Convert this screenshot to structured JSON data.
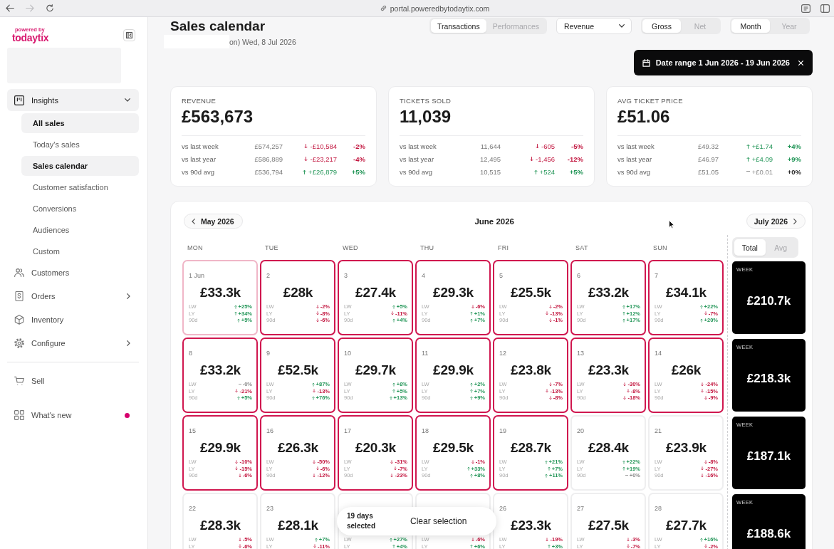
{
  "browser": {
    "nav_buttons": [
      {
        "kind": "back",
        "disabled": false
      },
      {
        "kind": "forward",
        "disabled": true
      },
      {
        "kind": "reload",
        "disabled": false
      }
    ],
    "url": "portal.poweredbytodaytix.com"
  },
  "sidebar": {
    "logo": {
      "tagline": "powered by",
      "wordmark": "todaytix"
    },
    "sections": [
      {
        "items": [
          {
            "label": "Insights",
            "kind": "group",
            "expanded": true,
            "unread": false,
            "children": [
              {
                "label": "All sales",
                "selected": true
              },
              {
                "label": "Today's sales",
                "selected": false
              },
              {
                "label": "Sales calendar",
                "selected": true
              },
              {
                "label": "Customer satisfaction",
                "selected": false
              },
              {
                "label": "Conversions",
                "selected": false
              },
              {
                "label": "Audiences",
                "selected": false
              },
              {
                "label": "Custom",
                "selected": false
              }
            ]
          },
          {
            "label": "Customers",
            "kind": "link",
            "unread": false
          },
          {
            "label": "Orders",
            "kind": "group",
            "expanded": false,
            "unread": false
          },
          {
            "label": "Inventory",
            "kind": "link",
            "unread": false
          },
          {
            "label": "Configure",
            "kind": "group",
            "expanded": false,
            "unread": false
          }
        ]
      },
      {
        "items": [
          {
            "label": "Sell",
            "kind": "link",
            "unread": false
          },
          {
            "label": "What's new",
            "kind": "link",
            "unread": true
          }
        ]
      }
    ]
  },
  "header": {
    "title": "Sales calendar",
    "subtitle": "on) Wed, 8 Jul 2026",
    "view_tabs": [
      {
        "label": "Transactions",
        "selected": true
      },
      {
        "label": "Performances",
        "selected": false
      }
    ],
    "metric_select": {
      "value": "Revenue"
    },
    "amount_tabs": [
      {
        "label": "Gross",
        "selected": true
      },
      {
        "label": "Net",
        "selected": false
      }
    ],
    "period_tabs": [
      {
        "label": "Month",
        "selected": true
      },
      {
        "label": "Year",
        "selected": false
      }
    ],
    "date_range": {
      "label": "Date range 1 Jun 2026 - 19 Jun 2026"
    }
  },
  "stats": [
    {
      "label": "REVENUE",
      "value": "£563,673",
      "rows": [
        {
          "label": "vs last week",
          "previous": "£574,257",
          "change": "-£10,584",
          "percent": "-2%",
          "kind": "down"
        },
        {
          "label": "vs last year",
          "previous": "£586,889",
          "change": "-£23,217",
          "percent": "-4%",
          "kind": "down"
        },
        {
          "label": "vs 90d avg",
          "previous": "£536,794",
          "change": "+£26,879",
          "percent": "+5%",
          "kind": "up"
        }
      ]
    },
    {
      "label": "TICKETS SOLD",
      "value": "11,039",
      "rows": [
        {
          "label": "vs last week",
          "previous": "11,644",
          "change": "-605",
          "percent": "-5%",
          "kind": "down"
        },
        {
          "label": "vs last year",
          "previous": "12,495",
          "change": "-1,456",
          "percent": "-12%",
          "kind": "down"
        },
        {
          "label": "vs 90d avg",
          "previous": "10,515",
          "change": "+524",
          "percent": "+5%",
          "kind": "up"
        }
      ]
    },
    {
      "label": "AVG TICKET PRICE",
      "value": "£51.06",
      "rows": [
        {
          "label": "vs last week",
          "previous": "£49.32",
          "change": "+£1.74",
          "percent": "+4%",
          "kind": "up"
        },
        {
          "label": "vs last year",
          "previous": "£46.97",
          "change": "+£4.09",
          "percent": "+9%",
          "kind": "up"
        },
        {
          "label": "vs 90d avg",
          "previous": "£51.05",
          "change": "+£0.01",
          "percent": "+0%",
          "kind": "flat"
        }
      ]
    }
  ],
  "calendar": {
    "prev_month": "May 2026",
    "title": "June 2026",
    "next_month": "July 2026",
    "weekdays": [
      "MON",
      "TUE",
      "WED",
      "THU",
      "FRI",
      "SAT",
      "SUN"
    ],
    "summary_tabs": [
      {
        "label": "Total",
        "selected": true
      },
      {
        "label": "Avg",
        "selected": false
      }
    ],
    "weeks": [
      {
        "days": [
          {
            "date": "1 Jun",
            "value": "£33.3k",
            "selected": true,
            "anchor": true,
            "metrics": [
              {
                "label": "LW",
                "change": "+25%",
                "kind": "up"
              },
              {
                "label": "LY",
                "change": "+34%",
                "kind": "up"
              },
              {
                "label": "90d",
                "change": "+5%",
                "kind": "up"
              }
            ]
          },
          {
            "date": "2",
            "value": "£28k",
            "selected": true,
            "anchor": false,
            "metrics": [
              {
                "label": "LW",
                "change": "-2%",
                "kind": "down"
              },
              {
                "label": "LY",
                "change": "-8%",
                "kind": "down"
              },
              {
                "label": "90d",
                "change": "-6%",
                "kind": "down"
              }
            ]
          },
          {
            "date": "3",
            "value": "£27.4k",
            "selected": true,
            "anchor": false,
            "metrics": [
              {
                "label": "LW",
                "change": "+5%",
                "kind": "up"
              },
              {
                "label": "LY",
                "change": "-11%",
                "kind": "down"
              },
              {
                "label": "90d",
                "change": "+4%",
                "kind": "up"
              }
            ]
          },
          {
            "date": "4",
            "value": "£29.3k",
            "selected": true,
            "anchor": false,
            "metrics": [
              {
                "label": "LW",
                "change": "-6%",
                "kind": "down"
              },
              {
                "label": "LY",
                "change": "+1%",
                "kind": "up"
              },
              {
                "label": "90d",
                "change": "+7%",
                "kind": "up"
              }
            ]
          },
          {
            "date": "5",
            "value": "£25.5k",
            "selected": true,
            "anchor": false,
            "metrics": [
              {
                "label": "LW",
                "change": "-2%",
                "kind": "down"
              },
              {
                "label": "LY",
                "change": "-13%",
                "kind": "down"
              },
              {
                "label": "90d",
                "change": "-1%",
                "kind": "down"
              }
            ]
          },
          {
            "date": "6",
            "value": "£33.2k",
            "selected": true,
            "anchor": false,
            "metrics": [
              {
                "label": "LW",
                "change": "+17%",
                "kind": "up"
              },
              {
                "label": "LY",
                "change": "+12%",
                "kind": "up"
              },
              {
                "label": "90d",
                "change": "+17%",
                "kind": "up"
              }
            ]
          },
          {
            "date": "7",
            "value": "£34.1k",
            "selected": true,
            "anchor": false,
            "metrics": [
              {
                "label": "LW",
                "change": "+22%",
                "kind": "up"
              },
              {
                "label": "LY",
                "change": "-7%",
                "kind": "down"
              },
              {
                "label": "90d",
                "change": "+20%",
                "kind": "up"
              }
            ]
          }
        ],
        "total": {
          "label": "WEEK",
          "value": "£210.7k"
        }
      },
      {
        "days": [
          {
            "date": "8",
            "value": "£33.2k",
            "selected": true,
            "anchor": false,
            "metrics": [
              {
                "label": "LW",
                "change": "-0%",
                "kind": "flat"
              },
              {
                "label": "LY",
                "change": "-21%",
                "kind": "down"
              },
              {
                "label": "90d",
                "change": "+5%",
                "kind": "up"
              }
            ]
          },
          {
            "date": "9",
            "value": "£52.5k",
            "selected": true,
            "anchor": false,
            "metrics": [
              {
                "label": "LW",
                "change": "+87%",
                "kind": "up"
              },
              {
                "label": "LY",
                "change": "-13%",
                "kind": "down"
              },
              {
                "label": "90d",
                "change": "+76%",
                "kind": "up"
              }
            ]
          },
          {
            "date": "10",
            "value": "£29.7k",
            "selected": true,
            "anchor": false,
            "metrics": [
              {
                "label": "LW",
                "change": "+8%",
                "kind": "up"
              },
              {
                "label": "LY",
                "change": "+5%",
                "kind": "up"
              },
              {
                "label": "90d",
                "change": "+13%",
                "kind": "up"
              }
            ]
          },
          {
            "date": "11",
            "value": "£29.9k",
            "selected": true,
            "anchor": false,
            "metrics": [
              {
                "label": "LW",
                "change": "+2%",
                "kind": "up"
              },
              {
                "label": "LY",
                "change": "+7%",
                "kind": "up"
              },
              {
                "label": "90d",
                "change": "+9%",
                "kind": "up"
              }
            ]
          },
          {
            "date": "12",
            "value": "£23.8k",
            "selected": true,
            "anchor": false,
            "metrics": [
              {
                "label": "LW",
                "change": "-7%",
                "kind": "down"
              },
              {
                "label": "LY",
                "change": "-13%",
                "kind": "down"
              },
              {
                "label": "90d",
                "change": "-8%",
                "kind": "down"
              }
            ]
          },
          {
            "date": "13",
            "value": "£23.3k",
            "selected": true,
            "anchor": false,
            "metrics": [
              {
                "label": "LW",
                "change": "-30%",
                "kind": "down"
              },
              {
                "label": "LY",
                "change": "-8%",
                "kind": "down"
              },
              {
                "label": "90d",
                "change": "-18%",
                "kind": "down"
              }
            ]
          },
          {
            "date": "14",
            "value": "£26k",
            "selected": true,
            "anchor": false,
            "metrics": [
              {
                "label": "LW",
                "change": "-24%",
                "kind": "down"
              },
              {
                "label": "LY",
                "change": "-15%",
                "kind": "down"
              },
              {
                "label": "90d",
                "change": "-9%",
                "kind": "down"
              }
            ]
          }
        ],
        "total": {
          "label": "WEEK",
          "value": "£218.3k"
        }
      },
      {
        "days": [
          {
            "date": "15",
            "value": "£29.9k",
            "selected": true,
            "anchor": false,
            "metrics": [
              {
                "label": "LW",
                "change": "-10%",
                "kind": "down"
              },
              {
                "label": "LY",
                "change": "-15%",
                "kind": "down"
              },
              {
                "label": "90d",
                "change": "-6%",
                "kind": "down"
              }
            ]
          },
          {
            "date": "16",
            "value": "£26.3k",
            "selected": true,
            "anchor": false,
            "metrics": [
              {
                "label": "LW",
                "change": "-50%",
                "kind": "down"
              },
              {
                "label": "LY",
                "change": "-6%",
                "kind": "down"
              },
              {
                "label": "90d",
                "change": "-12%",
                "kind": "down"
              }
            ]
          },
          {
            "date": "17",
            "value": "£20.3k",
            "selected": true,
            "anchor": false,
            "metrics": [
              {
                "label": "LW",
                "change": "-31%",
                "kind": "down"
              },
              {
                "label": "LY",
                "change": "-7%",
                "kind": "down"
              },
              {
                "label": "90d",
                "change": "-23%",
                "kind": "down"
              }
            ]
          },
          {
            "date": "18",
            "value": "£29.5k",
            "selected": true,
            "anchor": false,
            "metrics": [
              {
                "label": "LW",
                "change": "-1%",
                "kind": "down"
              },
              {
                "label": "LY",
                "change": "+33%",
                "kind": "up"
              },
              {
                "label": "90d",
                "change": "+8%",
                "kind": "up"
              }
            ]
          },
          {
            "date": "19",
            "value": "£28.7k",
            "selected": true,
            "anchor": false,
            "metrics": [
              {
                "label": "LW",
                "change": "+21%",
                "kind": "up"
              },
              {
                "label": "LY",
                "change": "+7%",
                "kind": "up"
              },
              {
                "label": "90d",
                "change": "+11%",
                "kind": "up"
              }
            ]
          },
          {
            "date": "20",
            "value": "£28.4k",
            "selected": false,
            "anchor": false,
            "metrics": [
              {
                "label": "LW",
                "change": "+22%",
                "kind": "up"
              },
              {
                "label": "LY",
                "change": "+19%",
                "kind": "up"
              },
              {
                "label": "90d",
                "change": "+0%",
                "kind": "flat"
              }
            ]
          },
          {
            "date": "21",
            "value": "£23.9k",
            "selected": false,
            "anchor": false,
            "metrics": [
              {
                "label": "LW",
                "change": "-8%",
                "kind": "down"
              },
              {
                "label": "LY",
                "change": "-27%",
                "kind": "down"
              },
              {
                "label": "90d",
                "change": "-16%",
                "kind": "down"
              }
            ]
          }
        ],
        "total": {
          "label": "WEEK",
          "value": "£187.1k"
        }
      },
      {
        "days": [
          {
            "date": "22",
            "value": "£28.3k",
            "selected": false,
            "anchor": false,
            "metrics": [
              {
                "label": "LW",
                "change": "-5%",
                "kind": "down"
              },
              {
                "label": "LY",
                "change": "-6%",
                "kind": "down"
              }
            ]
          },
          {
            "date": "23",
            "value": "£28.1k",
            "selected": false,
            "anchor": false,
            "metrics": [
              {
                "label": "LW",
                "change": "+7%",
                "kind": "up"
              },
              {
                "label": "LY",
                "change": "-11%",
                "kind": "down"
              }
            ]
          },
          {
            "selected": false,
            "anchor": false,
            "metrics": [
              {
                "label": "LW",
                "change": "+27%",
                "kind": "up"
              },
              {
                "label": "LY",
                "change": "+4%",
                "kind": "up"
              }
            ]
          },
          {
            "selected": false,
            "anchor": false,
            "metrics": [
              {
                "label": "LW",
                "change": "-6%",
                "kind": "down"
              },
              {
                "label": "LY",
                "change": "+6%",
                "kind": "up"
              }
            ]
          },
          {
            "date": "26",
            "value": "£23.3k",
            "selected": false,
            "anchor": false,
            "metrics": [
              {
                "label": "LW",
                "change": "-19%",
                "kind": "down"
              },
              {
                "label": "LY",
                "change": "+3%",
                "kind": "up"
              }
            ]
          },
          {
            "date": "27",
            "value": "£27.5k",
            "selected": false,
            "anchor": false,
            "metrics": [
              {
                "label": "LW",
                "change": "-3%",
                "kind": "down"
              },
              {
                "label": "LY",
                "change": "-7%",
                "kind": "down"
              }
            ]
          },
          {
            "date": "28",
            "value": "£27.7k",
            "selected": false,
            "anchor": false,
            "metrics": [
              {
                "label": "LW",
                "change": "+16%",
                "kind": "up"
              },
              {
                "label": "LY",
                "change": "-2%",
                "kind": "down"
              }
            ]
          }
        ],
        "total": {
          "label": "WEEK",
          "value": "£188.6k"
        }
      }
    ],
    "selection": {
      "count": "19 days selected",
      "action": "Clear selection"
    }
  }
}
